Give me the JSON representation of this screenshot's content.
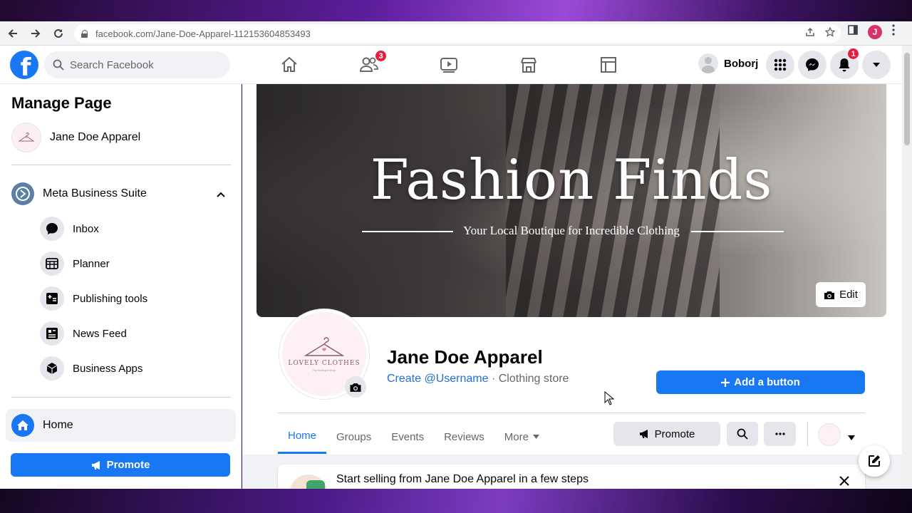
{
  "browser": {
    "url": "facebook.com/Jane-Doe-Apparel-112153604853493",
    "profile_initial": "J"
  },
  "topnav": {
    "search_placeholder": "Search Facebook",
    "friends_badge": "3",
    "notifications_badge": "1",
    "profile_name": "Boborj",
    "logo_letter": "f"
  },
  "sidebar": {
    "title": "Manage Page",
    "page_name": "Jane Doe Apparel",
    "business_suite": "Meta Business Suite",
    "items": [
      {
        "label": "Inbox",
        "icon": "chat-bubble-icon"
      },
      {
        "label": "Planner",
        "icon": "calendar-grid-icon"
      },
      {
        "label": "Publishing tools",
        "icon": "publishing-tools-icon"
      },
      {
        "label": "News Feed",
        "icon": "news-feed-icon"
      },
      {
        "label": "Business Apps",
        "icon": "cube-icon"
      }
    ],
    "home_label": "Home",
    "promote_label": "Promote"
  },
  "cover": {
    "title": "Fashion Finds",
    "subtitle": "Your Local Boutique for Incredible Clothing",
    "edit_label": "Edit"
  },
  "profile": {
    "brand_text": "LOVELY CLOTHES",
    "brand_sub": "my boutique shop",
    "name": "Jane Doe Apparel",
    "username_link": "Create @Username",
    "category": " · Clothing store",
    "add_button": "Add a button"
  },
  "tabs": [
    {
      "label": "Home",
      "active": true
    },
    {
      "label": "Groups"
    },
    {
      "label": "Events"
    },
    {
      "label": "Reviews"
    },
    {
      "label": "More"
    }
  ],
  "actions": {
    "promote_label": "Promote"
  },
  "sell_card": {
    "text": "Start selling from Jane Doe Apparel in a few steps"
  },
  "colors": {
    "brand_blue": "#1877f2",
    "badge_red": "#e41e3f"
  }
}
